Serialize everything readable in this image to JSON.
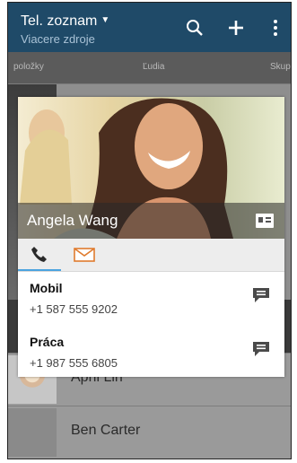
{
  "header": {
    "title": "Tel. zoznam",
    "subtitle": "Viacere zdroje",
    "search_icon": "search-icon",
    "add_icon": "plus-icon",
    "menu_icon": "more-vertical-icon"
  },
  "tabs": [
    "položky",
    "Ľudia",
    "Skup"
  ],
  "list": {
    "items": [
      {
        "name": "April Lin"
      },
      {
        "name": "Ben Carter"
      }
    ]
  },
  "card": {
    "name": "Angela Wang",
    "actions": {
      "call_icon": "phone-icon",
      "mail_icon": "mail-icon",
      "vcard_icon": "contact-card-icon"
    },
    "entries": [
      {
        "label": "Mobil",
        "number": "+1 587 555 9202",
        "icon": "message-icon"
      },
      {
        "label": "Práca",
        "number": "+1 987 555 6805",
        "icon": "message-icon"
      }
    ]
  },
  "colors": {
    "header": "#1f4a68",
    "accent": "#4aa3df"
  }
}
